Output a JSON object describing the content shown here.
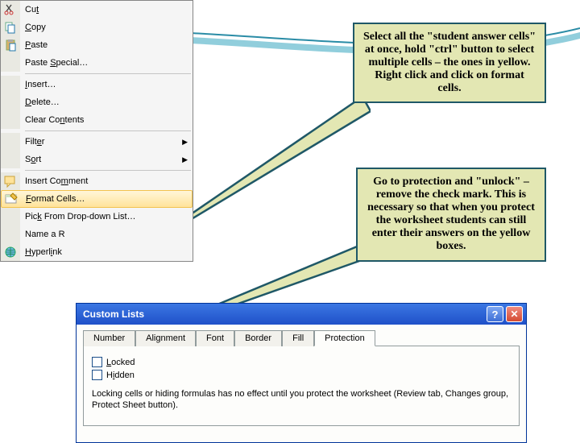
{
  "menu": {
    "cut": "Cut",
    "copy": "Copy",
    "paste": "Paste",
    "paste_special": "Paste Special…",
    "insert": "Insert…",
    "delete": "Delete…",
    "clear": "Clear Contents",
    "filter": "Filter",
    "sort": "Sort",
    "insert_comment": "Insert Comment",
    "format_cells": "Format Cells…",
    "pick_list": "Pick From Drop-down List…",
    "name_range": "Name a R",
    "hyperlink": "Hyperlink"
  },
  "callouts": {
    "c1": "Select all the \"student answer cells\" at once, hold \"ctrl\" button to select multiple cells – the ones in yellow.  Right click and click on format cells.",
    "c2": "Go to protection and \"unlock\" – remove the check mark. This is necessary so that when you protect the worksheet students can still enter their answers on the yellow boxes."
  },
  "dialog": {
    "title": "Custom Lists",
    "tabs": {
      "number": "Number",
      "alignment": "Alignment",
      "font": "Font",
      "border": "Border",
      "fill": "Fill",
      "protection": "Protection"
    },
    "locked": "Locked",
    "hidden": "Hidden",
    "hint": "Locking cells or hiding formulas has no effect until you protect the worksheet (Review tab, Changes group, Protect Sheet button)."
  }
}
